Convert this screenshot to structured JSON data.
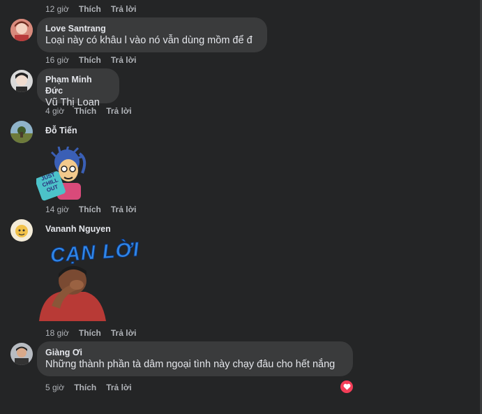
{
  "top_meta": {
    "time": "12 giờ",
    "like": "Thích",
    "reply": "Trả lời"
  },
  "comments": [
    {
      "author": "Love Santrang",
      "text": "Loại này có khâu l vào nó vẫn dùng mồm để đ",
      "time": "16 giờ",
      "like": "Thích",
      "reply": "Trả lời"
    },
    {
      "author": "Phạm Minh Đức",
      "text": "Vũ Thị Loan",
      "time": "4 giờ",
      "like": "Thích",
      "reply": "Trả lời"
    },
    {
      "author": "Đỗ Tiến",
      "sticker_text": "JUST CHILL OUT",
      "time": "14 giờ",
      "like": "Thích",
      "reply": "Trả lời"
    },
    {
      "author": "Vananh Nguyen",
      "sticker_text": "CẠN LỜI",
      "time": "18 giờ",
      "like": "Thích",
      "reply": "Trả lời"
    },
    {
      "author": "Giàng Ơi",
      "text": "Những thành phần tà dâm ngoại tình này chạy đâu cho hết nắng",
      "time": "5 giờ",
      "like": "Thích",
      "reply": "Trả lời",
      "reaction": "heart-icon"
    }
  ],
  "colors": {
    "background": "#242526",
    "bubble": "#3a3b3c",
    "text": "#e4e6eb",
    "meta": "#b0b3b8",
    "love_reaction": "#f33e58"
  }
}
